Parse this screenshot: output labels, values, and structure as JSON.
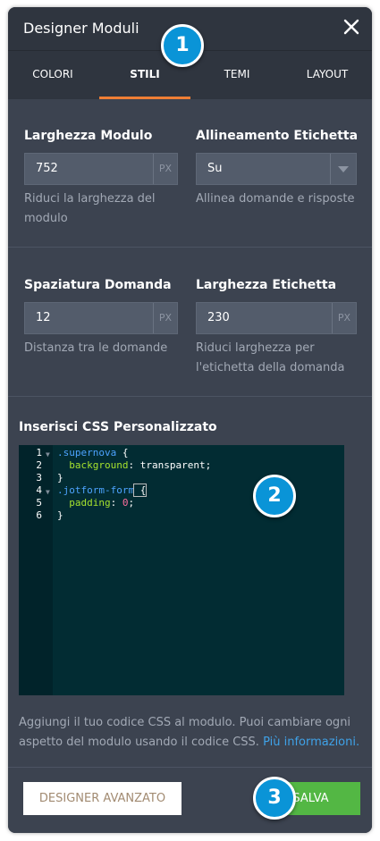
{
  "header": {
    "title": "Designer Moduli",
    "close_icon": "close-icon"
  },
  "tabs": [
    {
      "label": "COLORI",
      "active": false
    },
    {
      "label": "STILI",
      "active": true
    },
    {
      "label": "TEMI",
      "active": false
    },
    {
      "label": "LAYOUT",
      "active": false
    }
  ],
  "fields": {
    "form_width": {
      "label": "Larghezza Modulo",
      "value": "752",
      "unit": "PX",
      "help": [
        "Riduci la larghezza del",
        "modulo"
      ]
    },
    "label_alignment": {
      "label": "Allineamento Etichetta",
      "value": "Su",
      "help": [
        "Allinea domande e risposte"
      ]
    },
    "question_spacing": {
      "label": "Spaziatura Domanda",
      "value": "12",
      "unit": "PX",
      "help": [
        "Distanza tra le domande"
      ]
    },
    "label_width": {
      "label": "Larghezza Etichetta",
      "value": "230",
      "unit": "PX",
      "help": [
        "Riduci larghezza per",
        "l'etichetta della domanda"
      ]
    }
  },
  "css_editor": {
    "label": "Inserisci CSS Personalizzato",
    "lines": [
      {
        "n": "1",
        "fold": true,
        "t1": ".supernova",
        "t2": " {"
      },
      {
        "n": "2",
        "fold": false,
        "prop": "background",
        "val": " transparent;"
      },
      {
        "n": "3",
        "fold": false,
        "plain": "}"
      },
      {
        "n": "4",
        "fold": true,
        "t1": ".jotform-form",
        "t2": " {"
      },
      {
        "n": "5",
        "fold": false,
        "prop": "padding",
        "num": " 0",
        "tail": ";"
      },
      {
        "n": "6",
        "fold": false,
        "plain": "}"
      }
    ]
  },
  "info": {
    "text1": "Aggiungi il tuo codice CSS al modulo. Puoi cambiare ogni",
    "text2": "aspetto del modulo usando il codice CSS.",
    "link": "Più informazioni."
  },
  "footer": {
    "advanced_label": "DESIGNER AVANZATO",
    "save_label": "SALVA"
  },
  "badges": [
    "1",
    "2",
    "3"
  ],
  "colors": {
    "accent_tab": "#ef7e35",
    "save_button": "#53b744",
    "badge": "#0a94d7",
    "panel": "#3c4350",
    "link": "#3fa2e8"
  }
}
